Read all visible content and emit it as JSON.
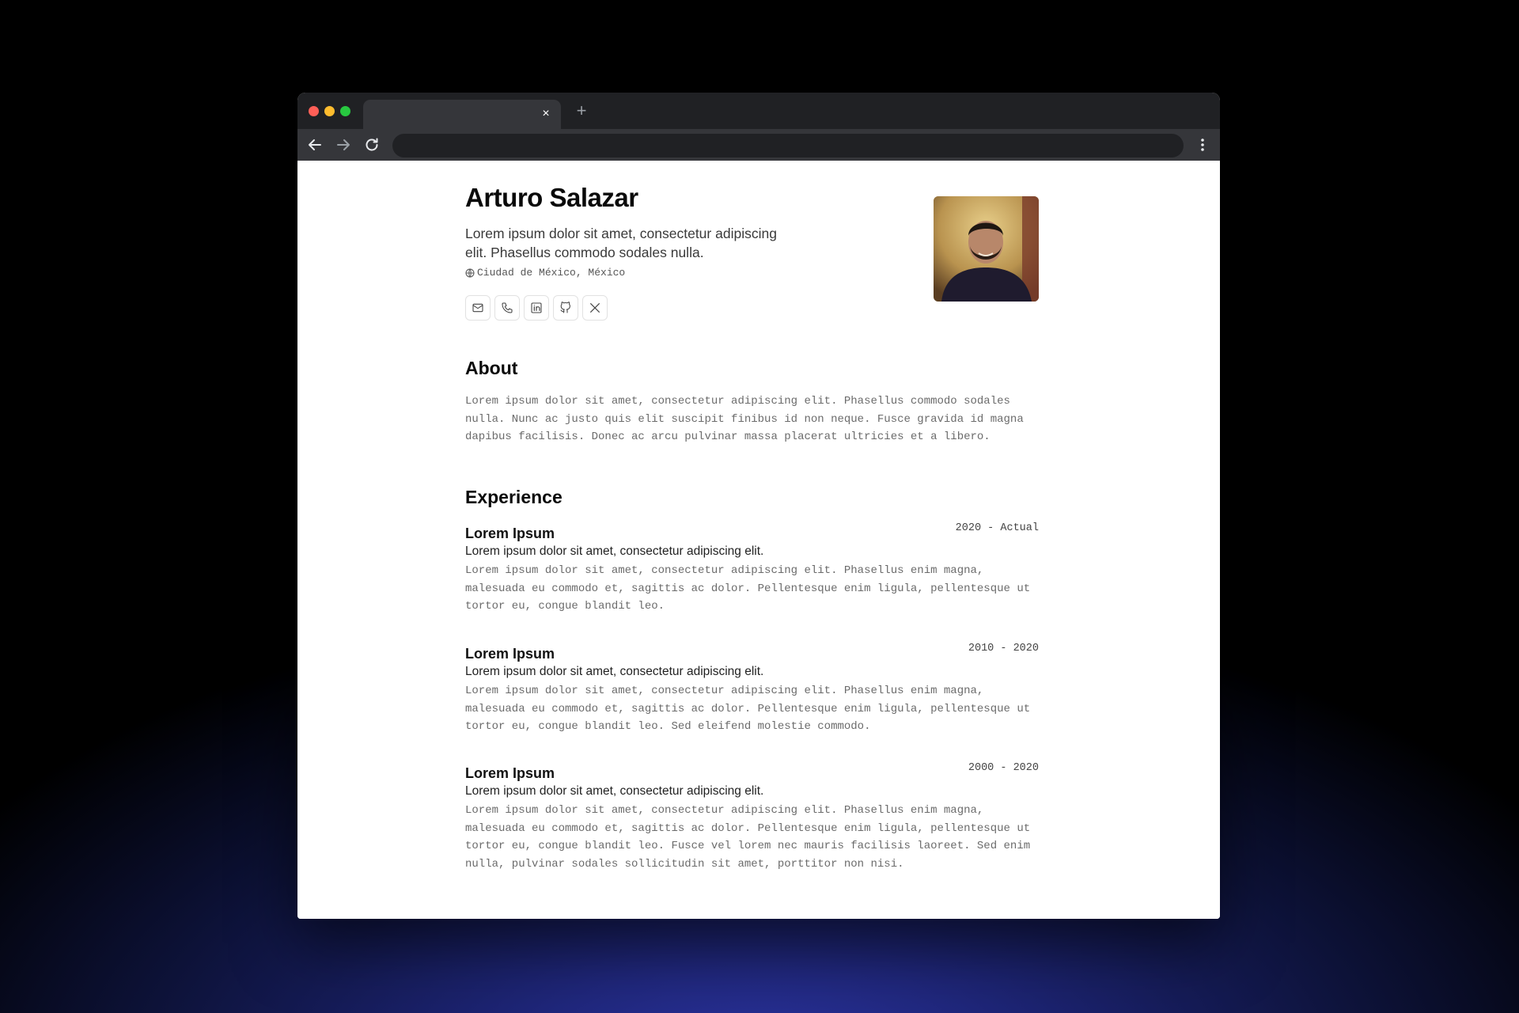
{
  "browser": {
    "tab_close": "×",
    "new_tab": "+"
  },
  "profile": {
    "name": "Arturo Salazar",
    "headline": "Lorem ipsum dolor sit amet, consectetur adipiscing elit. Phasellus commodo sodales nulla.",
    "location": "Ciudad de México, México",
    "socials": [
      "mail-icon",
      "phone-icon",
      "linkedin-icon",
      "github-icon",
      "x-icon"
    ]
  },
  "about": {
    "title": "About",
    "text": "Lorem ipsum dolor sit amet, consectetur adipiscing elit. Phasellus commodo sodales nulla. Nunc ac justo quis elit suscipit finibus id non neque. Fusce gravida id magna dapibus facilisis. Donec ac arcu pulvinar massa placerat ultricies et a libero."
  },
  "experience": {
    "title": "Experience",
    "jobs": [
      {
        "company": "Lorem Ipsum",
        "period": "2020 - Actual",
        "title": "Lorem ipsum dolor sit amet, consectetur adipiscing elit.",
        "description": "Lorem ipsum dolor sit amet, consectetur adipiscing elit. Phasellus enim magna, malesuada eu commodo et, sagittis ac dolor. Pellentesque enim ligula, pellentesque ut tortor eu, congue blandit leo."
      },
      {
        "company": "Lorem Ipsum",
        "period": "2010 - 2020",
        "title": "Lorem ipsum dolor sit amet, consectetur adipiscing elit.",
        "description": "Lorem ipsum dolor sit amet, consectetur adipiscing elit. Phasellus enim magna, malesuada eu commodo et, sagittis ac dolor. Pellentesque enim ligula, pellentesque ut tortor eu, congue blandit leo. Sed eleifend molestie commodo."
      },
      {
        "company": "Lorem Ipsum",
        "period": "2000 - 2020",
        "title": "Lorem ipsum dolor sit amet, consectetur adipiscing elit.",
        "description": "Lorem ipsum dolor sit amet, consectetur adipiscing elit. Phasellus enim magna, malesuada eu commodo et, sagittis ac dolor. Pellentesque enim ligula, pellentesque ut tortor eu, congue blandit leo. Fusce vel lorem nec mauris facilisis laoreet. Sed enim nulla, pulvinar sodales sollicitudin sit amet, porttitor non nisi."
      }
    ]
  }
}
